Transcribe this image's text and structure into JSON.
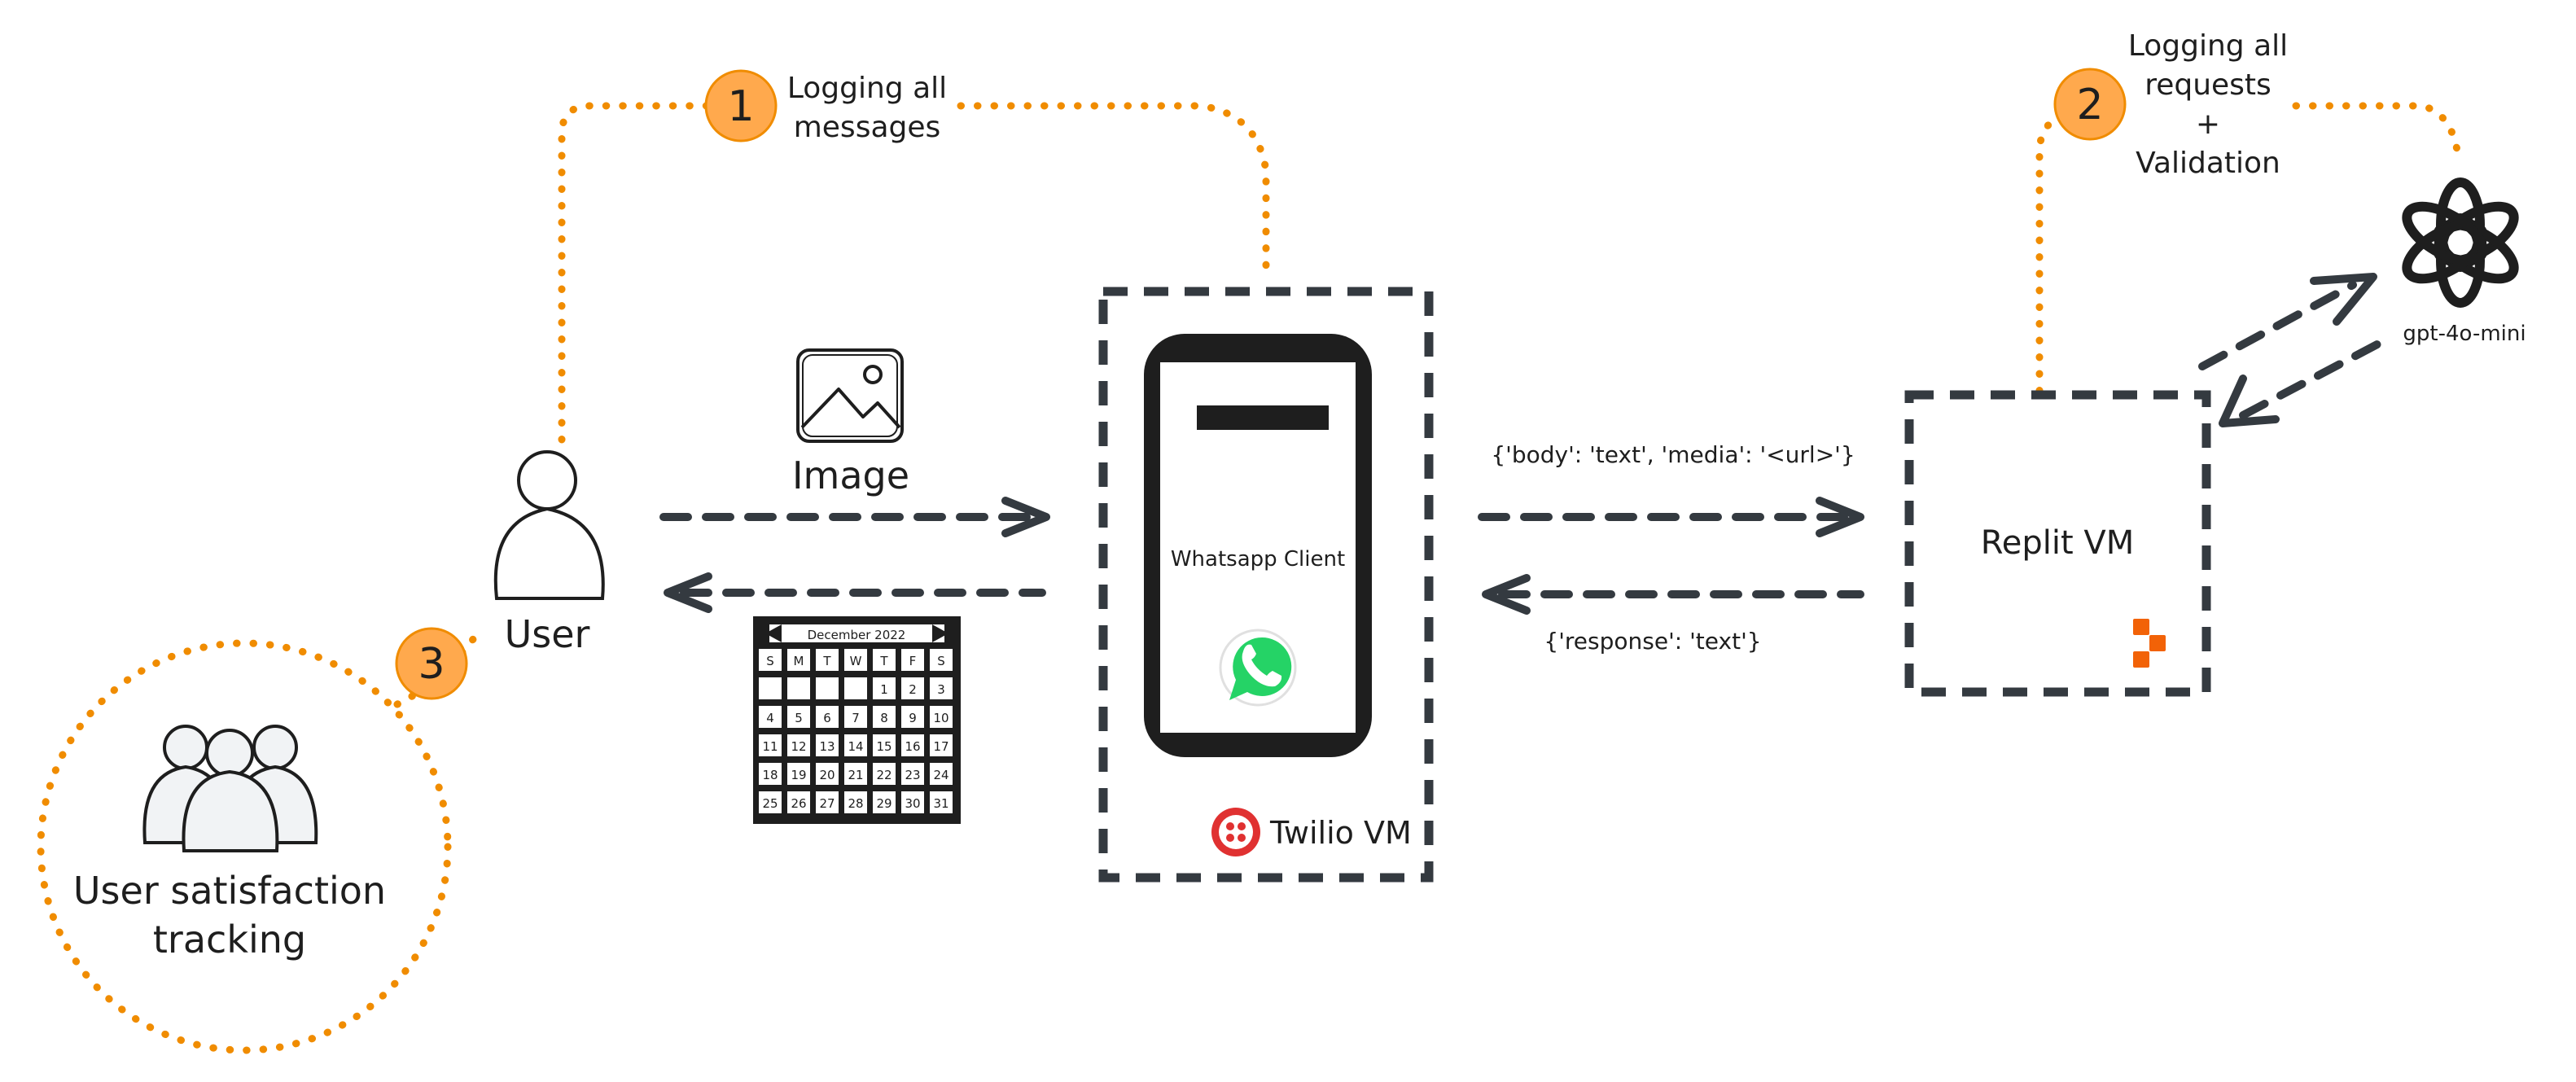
{
  "labels": {
    "user": "User",
    "image": "Image",
    "whatsapp_client": "Whatsapp Client",
    "twilio_vm": "Twilio VM",
    "replit_vm": "Replit VM",
    "gpt_model": "gpt-4o-mini",
    "request_payload": "{'body': 'text', 'media': '<url>'}",
    "response_payload": "{'response': 'text'}",
    "satisfaction_line1": "User satisfaction",
    "satisfaction_line2": "tracking",
    "calendar_month": "December 2022"
  },
  "steps": [
    {
      "number": "1",
      "lines": [
        "Logging all",
        "messages"
      ]
    },
    {
      "number": "2",
      "lines": [
        "Logging all",
        "requests",
        "+",
        "Validation"
      ]
    },
    {
      "number": "3",
      "lines": []
    }
  ],
  "calendar": {
    "weekdays": [
      "S",
      "M",
      "T",
      "W",
      "T",
      "F",
      "S"
    ],
    "rows": [
      [
        "",
        "",
        "",
        "",
        "1",
        "2",
        "3"
      ],
      [
        "4",
        "5",
        "6",
        "7",
        "8",
        "9",
        "10"
      ],
      [
        "11",
        "12",
        "13",
        "14",
        "15",
        "16",
        "17"
      ],
      [
        "18",
        "19",
        "20",
        "21",
        "22",
        "23",
        "24"
      ],
      [
        "25",
        "26",
        "27",
        "28",
        "29",
        "30",
        "31"
      ]
    ]
  },
  "colors": {
    "accent_orange": "#f08c00",
    "badge_fill": "#ffa94d",
    "twilio_red": "#e03131",
    "whatsapp_green": "#25d366",
    "twilio_box_fill": "#f8f1ee",
    "replit_box_fill": "#ebfbee",
    "replit_orange": "#f26207",
    "stroke_dark": "#343a40"
  }
}
